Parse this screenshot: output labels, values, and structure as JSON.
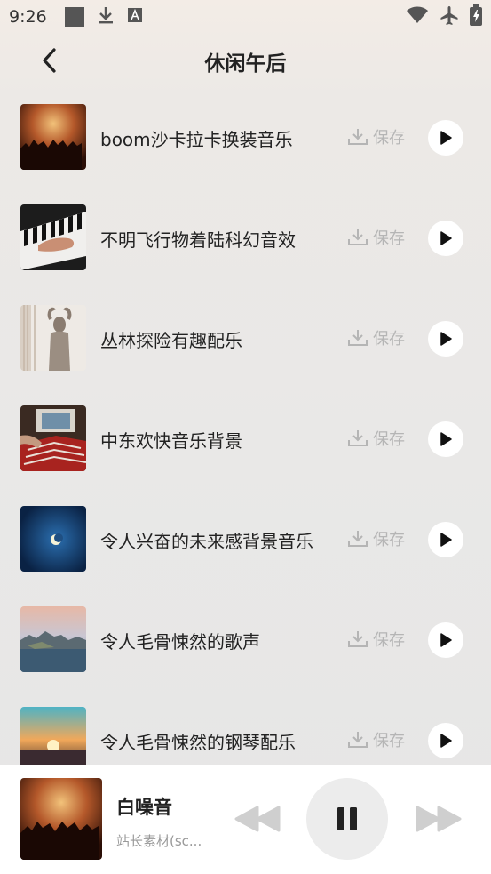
{
  "status_bar": {
    "time": "9:26",
    "icons": [
      "notification-square-icon",
      "download-icon",
      "a-badge-icon",
      "wifi-icon",
      "airplane-icon",
      "battery-charging-icon"
    ]
  },
  "header": {
    "title": "休闲午后",
    "back_icon": "chevron-left-icon"
  },
  "tracks": [
    {
      "title": "boom沙卡拉卡换装音乐",
      "save_label": "保存",
      "thumb": "concert-crowd"
    },
    {
      "title": "不明飞行物着陆科幻音效",
      "save_label": "保存",
      "thumb": "piano-hands"
    },
    {
      "title": "丛林探险有趣配乐",
      "save_label": "保存",
      "thumb": "shadow-curtain"
    },
    {
      "title": "中东欢快音乐背景",
      "save_label": "保存",
      "thumb": "vinyl-records"
    },
    {
      "title": "令人兴奋的未来感背景音乐",
      "save_label": "保存",
      "thumb": "moon-night"
    },
    {
      "title": "令人毛骨悚然的歌声",
      "save_label": "保存",
      "thumb": "coast-sunset"
    },
    {
      "title": "令人毛骨悚然的钢琴配乐",
      "save_label": "保存",
      "thumb": "sunset-horizon"
    }
  ],
  "player": {
    "title": "白噪音",
    "subtitle": "站长素材(sc...",
    "thumb": "concert-crowd"
  },
  "colors": {
    "save_gray": "#b5b5b5",
    "play_bg": "#ffffff",
    "player_bg": "#ffffff",
    "pause_bg": "#ececec"
  }
}
